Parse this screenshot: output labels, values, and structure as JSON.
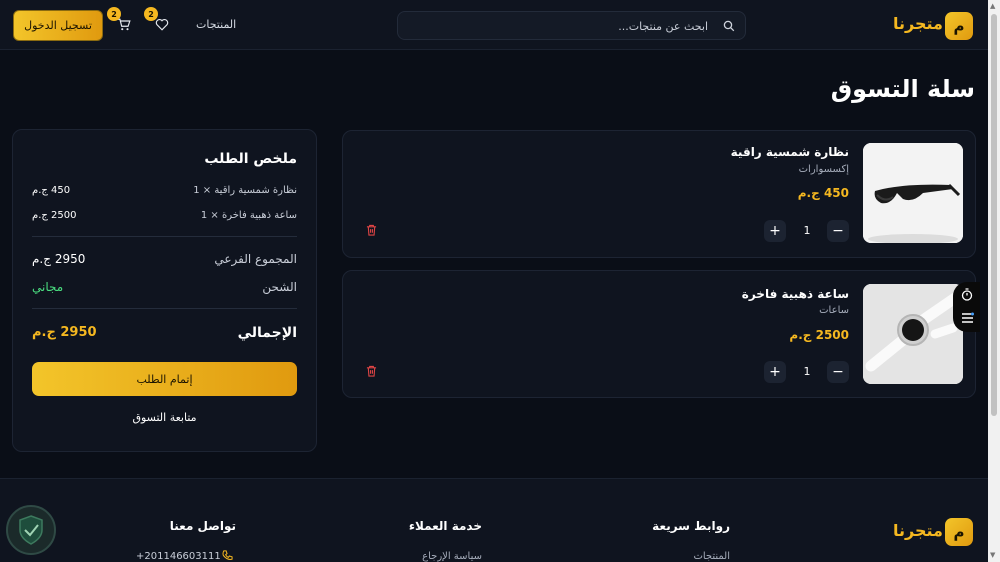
{
  "header": {
    "logo_letter": "م",
    "logo_name": "متجرنا",
    "search_placeholder": "ابحث عن منتجات...",
    "nav_products": "المنتجات",
    "wishlist_count": "2",
    "cart_count": "2",
    "login_label": "تسجيل الدخول"
  },
  "page_title": "سلة التسوق",
  "cart_items": [
    {
      "name": "نظارة شمسية راقية",
      "category": "إكسسوارات",
      "price": "450 ج.م",
      "quantity": "1"
    },
    {
      "name": "ساعة ذهبية فاخرة",
      "category": "ساعات",
      "price": "2500 ج.م",
      "quantity": "1"
    }
  ],
  "summary": {
    "title": "ملخص الطلب",
    "lines": [
      {
        "label": "نظارة شمسية راقية × 1",
        "value": "450 ج.م"
      },
      {
        "label": "ساعة ذهبية فاخرة × 1",
        "value": "2500 ج.م"
      }
    ],
    "subtotal_label": "المجموع الفرعي",
    "subtotal_value": "2950 ج.م",
    "shipping_label": "الشحن",
    "shipping_value": "مجاني",
    "total_label": "الإجمالي",
    "total_value": "2950 ج.م",
    "checkout_label": "إتمام الطلب",
    "continue_label": "متابعة التسوق"
  },
  "footer": {
    "logo_letter": "م",
    "logo_name": "متجرنا",
    "quick_links_title": "روابط سريعة",
    "quick_link_1": "المنتجات",
    "customer_service_title": "خدمة العملاء",
    "customer_service_link_1": "سياسة الإرجاع",
    "contact_title": "تواصل معنا",
    "phone": "+201146603111"
  },
  "colors": {
    "accent": "#f5b820",
    "background": "#0a0e17",
    "card": "#0f141f",
    "success": "#4ade80",
    "danger": "#e04545"
  }
}
